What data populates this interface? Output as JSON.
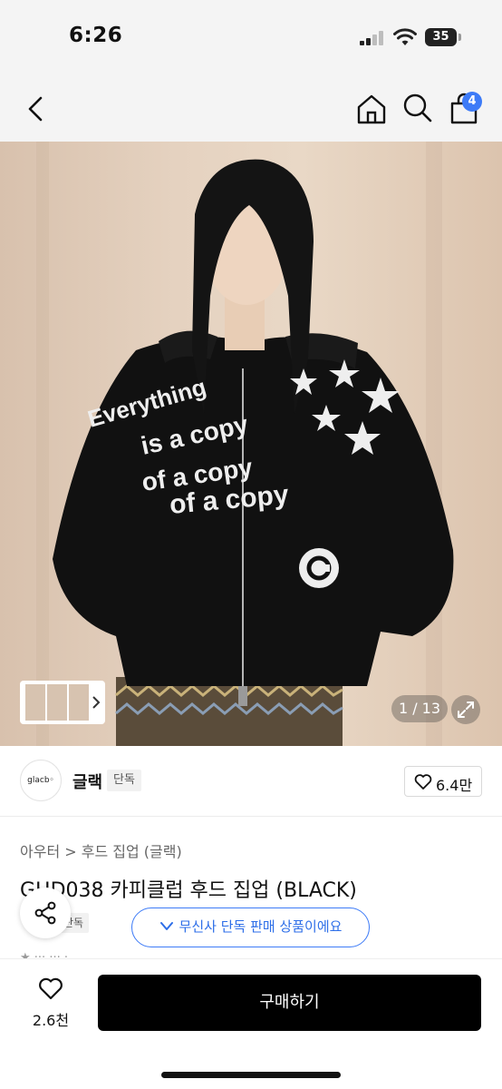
{
  "status_bar": {
    "time": "6:26",
    "battery": "35"
  },
  "nav": {
    "cart_badge": "4"
  },
  "gallery": {
    "counter": "1 / 13"
  },
  "brand": {
    "logo_text": "glacb◦",
    "name": "글랙",
    "tag": "단독",
    "likes": "6.4만"
  },
  "product": {
    "category": "아우터 > 후드 집업 (글랙)",
    "title": "GHD038 카피클럽 후드 집업 (BLACK)",
    "exclusive_tag": "단독"
  },
  "banner": {
    "exclusive_text": "무신사 단독 판매 상품이에요"
  },
  "bottom": {
    "wish_count": "2.6천",
    "buy_label": "구매하기"
  },
  "colors": {
    "accent": "#3d7bf7",
    "buy_button": "#000000",
    "hoodie": "#111111"
  },
  "icons": [
    "back-icon",
    "home-icon",
    "search-icon",
    "cart-icon",
    "expand-icon",
    "heart-icon",
    "share-icon",
    "check-icon"
  ]
}
